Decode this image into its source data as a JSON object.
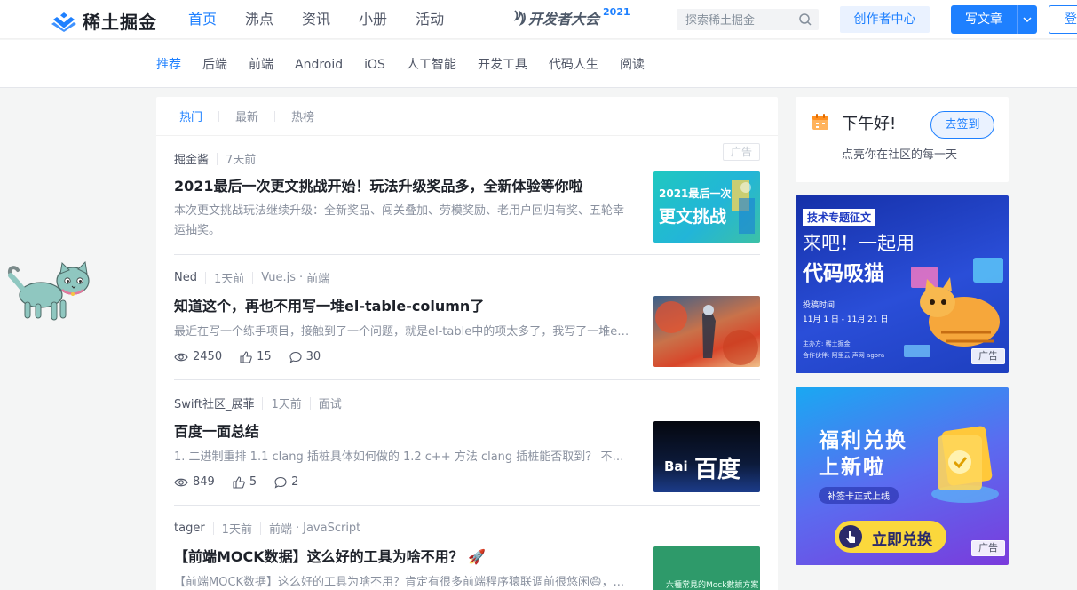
{
  "header": {
    "logo_text": "稀土掘金",
    "nav": [
      "首页",
      "沸点",
      "资讯",
      "小册",
      "活动"
    ],
    "nav_active": "首页",
    "devcon": {
      "label": "开发者大会",
      "year": "2021"
    },
    "search_placeholder": "探索稀土掘金",
    "creator_center": "创作者中心",
    "write_article": "写文章",
    "login": "登录"
  },
  "subnav": {
    "items": [
      "推荐",
      "后端",
      "前端",
      "Android",
      "iOS",
      "人工智能",
      "开发工具",
      "代码人生",
      "阅读"
    ],
    "active": "推荐"
  },
  "feed": {
    "tabs": [
      "热门",
      "最新",
      "热榜"
    ],
    "active_tab": "热门",
    "entries": [
      {
        "author": "掘金酱",
        "time": "7天前",
        "tags": [],
        "ad": "广告",
        "title": "2021最后一次更文挑战开始！玩法升级奖品多，全新体验等你啦",
        "abstract": "本次更文挑战玩法继续升级：全新奖品、闯关叠加、劳模奖励、老用户回归有奖、五轮幸运抽奖。",
        "thumb_text": [
          "2021最后一次",
          "更文挑战"
        ]
      },
      {
        "author": "Ned",
        "time": "1天前",
        "tags": [
          "Vue.js",
          "前端"
        ],
        "title": "知道这个，再也不用写一堆el-table-column了",
        "abstract": "最近在写一个练手项目，接触到了一个问题，就是el-table中的项太多了，我写了一堆el...",
        "views": "2450",
        "likes": "15",
        "comments": "30"
      },
      {
        "author": "Swift社区_展菲",
        "time": "1天前",
        "tags": [
          "面试"
        ],
        "title": "百度一面总结",
        "abstract": "1. 二进制重排 1.1 clang 插桩具体如何做的 1.2 c++ 方法 clang 插桩能否取到？ 不能 ...",
        "views": "849",
        "likes": "5",
        "comments": "2",
        "thumb_text": [
          "Bai",
          "百度"
        ]
      },
      {
        "author": "tager",
        "time": "1天前",
        "tags": [
          "前端",
          "JavaScript"
        ],
        "title": "【前端MOCK数据】这么好的工具为啥不用？ 🚀",
        "abstract": "【前端MOCK数据】这么好的工具为啥不用？肯定有很多前端程序猿联调前很悠闲😄，...",
        "thumb_text": "六種常見的Mock數據方案"
      }
    ]
  },
  "sidebar": {
    "greeting": "下午好!",
    "tip": "点亮你在社区的每一天",
    "checkin": "去签到",
    "banner1": {
      "tag": "技术专题征文",
      "line1": "来吧！一起用",
      "line2": "代码吸猫",
      "period_label": "投稿时间",
      "period": "11月 1 日 - 11月 21 日",
      "organizer": "主办方: 稀土掘金",
      "partners": "合作伙伴: 阿里云 声网 agora",
      "badge": "广告"
    },
    "banner2": {
      "line1": "福利兑换",
      "line2": "上新啦",
      "sub": "补签卡正式上线",
      "cta": "立即兑换",
      "badge": "广告"
    }
  },
  "colors": {
    "brand": "#1e80ff",
    "text_primary": "#1d2129",
    "text_secondary": "#8a919f",
    "background": "#f4f5f5"
  }
}
